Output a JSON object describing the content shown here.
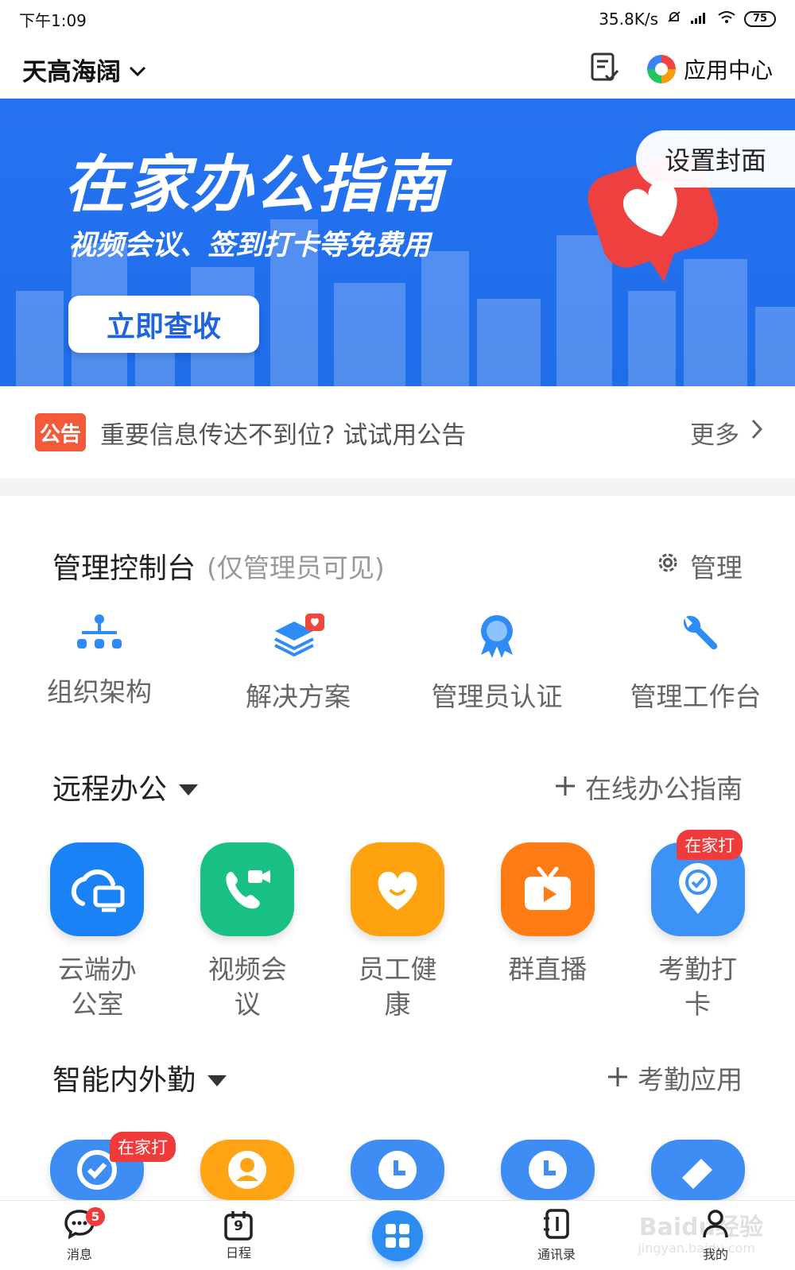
{
  "status_bar": {
    "time": "下午1:09",
    "network_speed": "35.8K/s",
    "battery": "75"
  },
  "header": {
    "org_name": "天高海阔",
    "app_center_label": "应用中心"
  },
  "banner": {
    "title": "在家办公指南",
    "subtitle": "视频会议、签到打卡等免费用",
    "cta_label": "立即查收",
    "cover_button_label": "设置封面"
  },
  "notice": {
    "badge": "公告",
    "text": "重要信息传达不到位? 试试用公告",
    "more_label": "更多"
  },
  "admin_console": {
    "title": "管理控制台",
    "hint": "(仅管理员可见)",
    "manage_label": "管理",
    "items": [
      {
        "label": "组织架构",
        "icon": "org-chart-icon"
      },
      {
        "label": "解决方案",
        "icon": "solution-layers-icon"
      },
      {
        "label": "管理员认证",
        "icon": "badge-ribbon-icon"
      },
      {
        "label": "管理工作台",
        "icon": "wrench-icon"
      }
    ]
  },
  "remote_office": {
    "title": "远程办公",
    "action_label": "在线办公指南",
    "apps": [
      {
        "label": "云端办公室",
        "icon": "cloud-desktop-icon",
        "color": "#1a82f4"
      },
      {
        "label": "视频会议",
        "icon": "video-call-icon",
        "color": "#19c083"
      },
      {
        "label": "员工健康",
        "icon": "heart-smile-icon",
        "color": "#ffa20f"
      },
      {
        "label": "群直播",
        "icon": "live-tv-icon",
        "color": "#ff7b14"
      },
      {
        "label": "考勤打卡",
        "icon": "location-check-icon",
        "color": "#3d93f5",
        "tag": "在家打"
      }
    ]
  },
  "attendance": {
    "title": "智能内外勤",
    "action_label": "考勤应用",
    "apps": [
      {
        "icon": "check-circle-icon",
        "color": "#3d8df5",
        "tag": "在家打"
      },
      {
        "icon": "person-icon",
        "color": "#ffa414"
      },
      {
        "icon": "clock-icon",
        "color": "#3d8df5"
      },
      {
        "icon": "clock-icon",
        "color": "#3d8df5"
      },
      {
        "icon": "eraser-icon",
        "color": "#3d8df5"
      }
    ]
  },
  "bottom_nav": {
    "items": [
      {
        "label": "消息",
        "icon": "chat-bubble-icon",
        "badge": "5"
      },
      {
        "label": "日程",
        "icon": "calendar-icon",
        "day": "9"
      },
      {
        "label": "",
        "icon": "workbench-grid-icon"
      },
      {
        "label": "通讯录",
        "icon": "contacts-book-icon"
      },
      {
        "label": "我的",
        "icon": "person-icon"
      }
    ]
  },
  "watermark": {
    "text": "Baidu经验",
    "sub": "jingyan.baidu.com"
  }
}
